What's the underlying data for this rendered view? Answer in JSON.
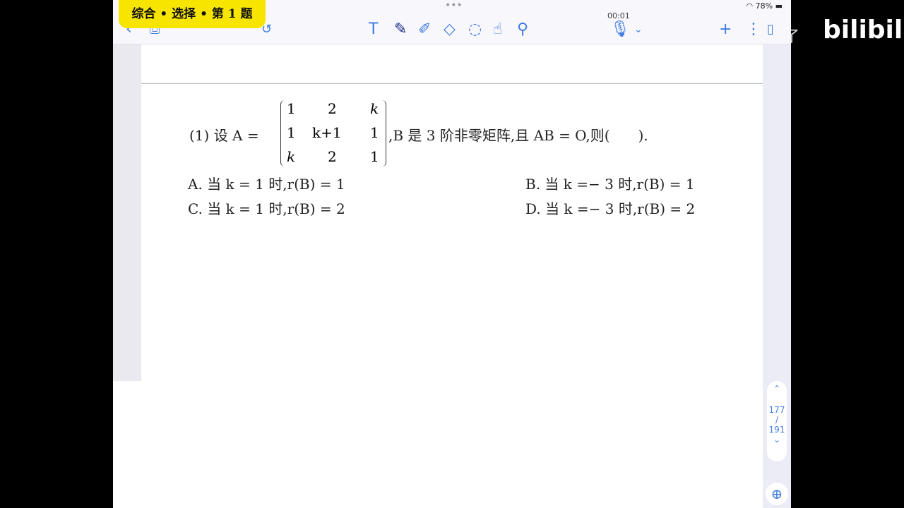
{
  "badge": "综合 • 选择 • 第 1 题",
  "status": {
    "battery": "78%",
    "timer": "00:01"
  },
  "watermark": {
    "text": "了",
    "logo": "bilibili"
  },
  "question": {
    "prefix": "(1) 设 A =",
    "matrix": [
      [
        "1",
        "2",
        "k"
      ],
      [
        "1",
        "k+1",
        "1"
      ],
      [
        "k",
        "2",
        "1"
      ]
    ],
    "suffix": ",B 是 3 阶非零矩阵,且 AB = O,则(　　).",
    "options": [
      "A. 当 k = 1 时,r(B) = 1",
      "B. 当 k =− 3 时,r(B) = 1",
      "C. 当 k = 1 时,r(B) = 2",
      "D. 当 k =− 3 时,r(B) = 2"
    ]
  },
  "pager": {
    "current": "177",
    "sep": "/",
    "total": "191"
  }
}
